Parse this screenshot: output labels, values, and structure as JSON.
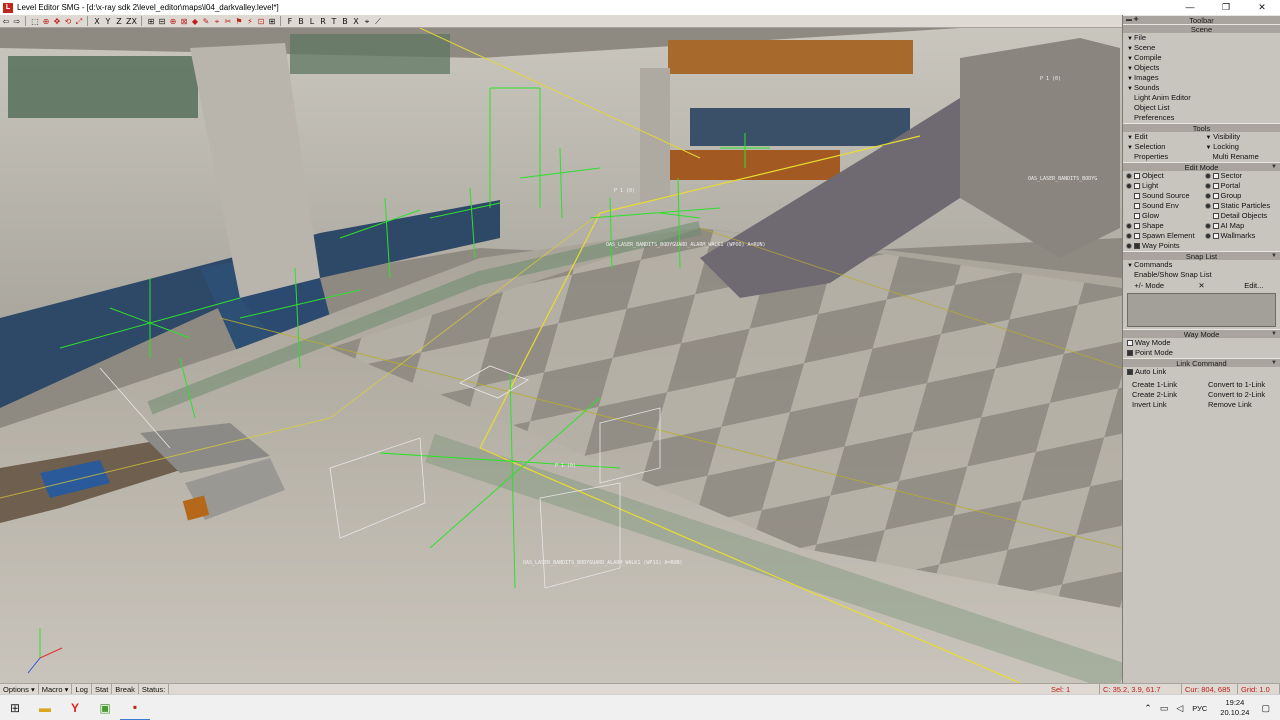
{
  "window": {
    "title": "Level Editor SMG - [d:\\x-ray sdk 2\\level_editor\\maps\\l04_darkvalley.level*]",
    "minimize": "—",
    "restore": "❐",
    "close": "✕"
  },
  "toolbar": {
    "buttons": [
      "⇦",
      "⇨",
      "⬚",
      "⊕",
      "✥",
      "⟲",
      "⤢",
      "X",
      "Y",
      "Z",
      "ZX",
      "⊞",
      "⊟",
      "⊕",
      "⊠",
      "◆",
      "✎",
      "⌖",
      "✂",
      "⚑",
      "⚡",
      "⊡",
      "⊞",
      "F",
      "B",
      "L",
      "R",
      "T",
      "B",
      "X",
      "⌖",
      "⟋"
    ]
  },
  "viewport": {
    "labels": [
      "OAS_LASER_BANDITS_BODYGUARD_ALARM_WALK1 (WPOO) A=RUN)",
      "OAS_LASER_BANDITS_BODYGUARD_ALARM_WALK1 (WP1S) A=RUN)",
      "OAS_LASER_BANDITS_BODYG",
      "P 1 (0)",
      "P 1 (0)",
      "P 1 (0)"
    ]
  },
  "panel": {
    "toolbar_header": "Toolbar",
    "scene_header": "Scene",
    "scene_items": [
      "File",
      "Scene",
      "Compile",
      "Objects",
      "Images",
      "Sounds"
    ],
    "scene_links": [
      "Light Anim Editor",
      "Object List",
      "Preferences"
    ],
    "tools_header": "Tools",
    "tools_rows": [
      [
        "Edit",
        "Visibility"
      ],
      [
        "Selection",
        "Locking"
      ],
      [
        "Properties",
        "Multi Rename"
      ]
    ],
    "edit_mode_header": "Edit Mode",
    "edit_mode_left": [
      "Object",
      "Light",
      "Sound Source",
      "Sound Env",
      "Glow",
      "Shape",
      "Spawn Element",
      "Way Points"
    ],
    "edit_mode_right": [
      "Sector",
      "Portal",
      "Group",
      "Static Particles",
      "Detail Objects",
      "AI Map",
      "Wallmarks"
    ],
    "snap_list_header": "Snap List",
    "snap_commands": "Commands",
    "snap_enable": "Enable/Show Snap List",
    "snap_toolbar": [
      "+/- Mode",
      "✕",
      "Edit..."
    ],
    "way_mode_header": "Way Mode",
    "way_mode_items": [
      "Way Mode",
      "Point Mode"
    ],
    "link_command_header": "Link Command",
    "auto_link": "Auto Link",
    "link_rows": [
      [
        "Create 1-Link",
        "Convert to 1-Link"
      ],
      [
        "Create 2-Link",
        "Convert to 2-Link"
      ],
      [
        "Invert Link",
        "Remove Link"
      ]
    ]
  },
  "statusbar": {
    "options": "Options",
    "macro": "Macro",
    "log": "Log",
    "stat": "Stat",
    "break": "Break",
    "status": "Status:",
    "sel": "Sel: 1",
    "coords": "C: 35.2, 3.9, 61.7",
    "cursor": "Cur: 804, 685",
    "grid": "Grid: 1.0"
  },
  "taskbar": {
    "lang": "РУС",
    "time": "19:24",
    "date": "20.10.24"
  },
  "colors": {
    "accent_red": "#c0201a",
    "panel_bg": "#c8c5bf",
    "toolbar_bg": "#dedad3",
    "wireframe_green": "#28e02a",
    "path_yellow": "#e8d820"
  }
}
